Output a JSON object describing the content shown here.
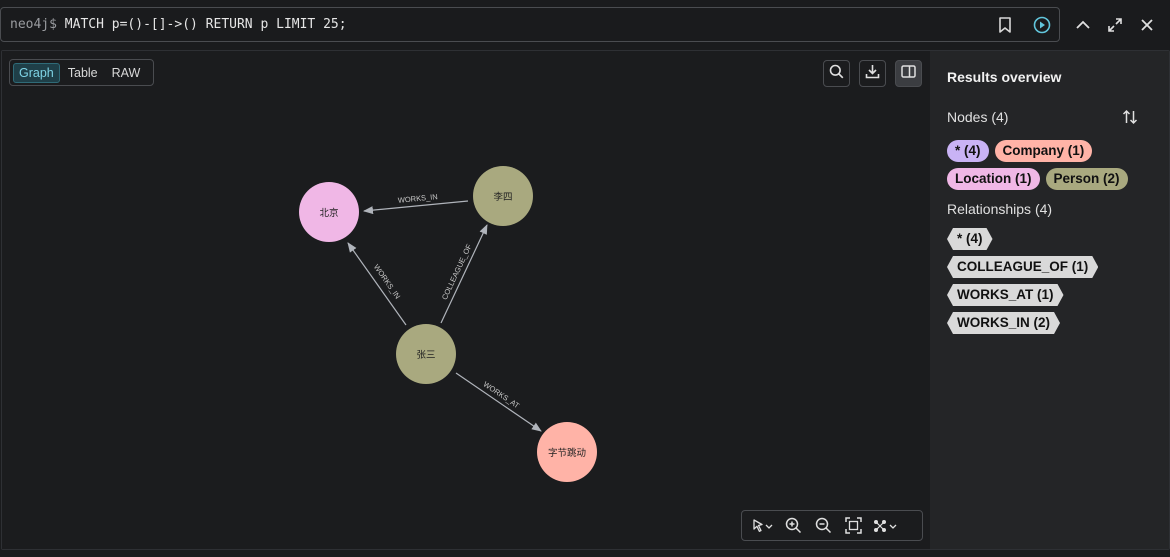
{
  "query": {
    "prompt": "neo4j$",
    "text": "MATCH p=()-[]->() RETURN p LIMIT 25;"
  },
  "view_tabs": [
    "Graph",
    "Table",
    "RAW"
  ],
  "active_view": "Graph",
  "graph": {
    "nodes": {
      "beijing": {
        "label": "北京",
        "color": "#f0b7e6"
      },
      "lisi": {
        "label": "李四",
        "color": "#a9a97f"
      },
      "zhangsan": {
        "label": "张三",
        "color": "#a9a97f"
      },
      "bytedance": {
        "label": "字节跳动",
        "color": "#ffb3a7"
      }
    },
    "edges": {
      "lisi_beijing": "WORKS_IN",
      "zhangsan_beijing": "WORKS_IN",
      "zhangsan_lisi": "COLLEAGUE_OF",
      "zhangsan_bytedance": "WORKS_AT"
    }
  },
  "sidebar": {
    "title": "Results overview",
    "nodes_title": "Nodes (4)",
    "node_chips": [
      {
        "label": "* (4)",
        "color": "#c9b3f5"
      },
      {
        "label": "Company (1)",
        "color": "#ffb3a7"
      },
      {
        "label": "Location (1)",
        "color": "#f0b7e6"
      },
      {
        "label": "Person (2)",
        "color": "#a9a97f"
      }
    ],
    "relationships_title": "Relationships (4)",
    "rel_chips": [
      "* (4)",
      "COLLEAGUE_OF (1)",
      "WORKS_AT (1)",
      "WORKS_IN (2)"
    ]
  },
  "colors": {
    "background": "#1b1c1e",
    "sidebar": "#242527",
    "accent": "#7fd4e6",
    "edge": "#b0b4bb"
  }
}
